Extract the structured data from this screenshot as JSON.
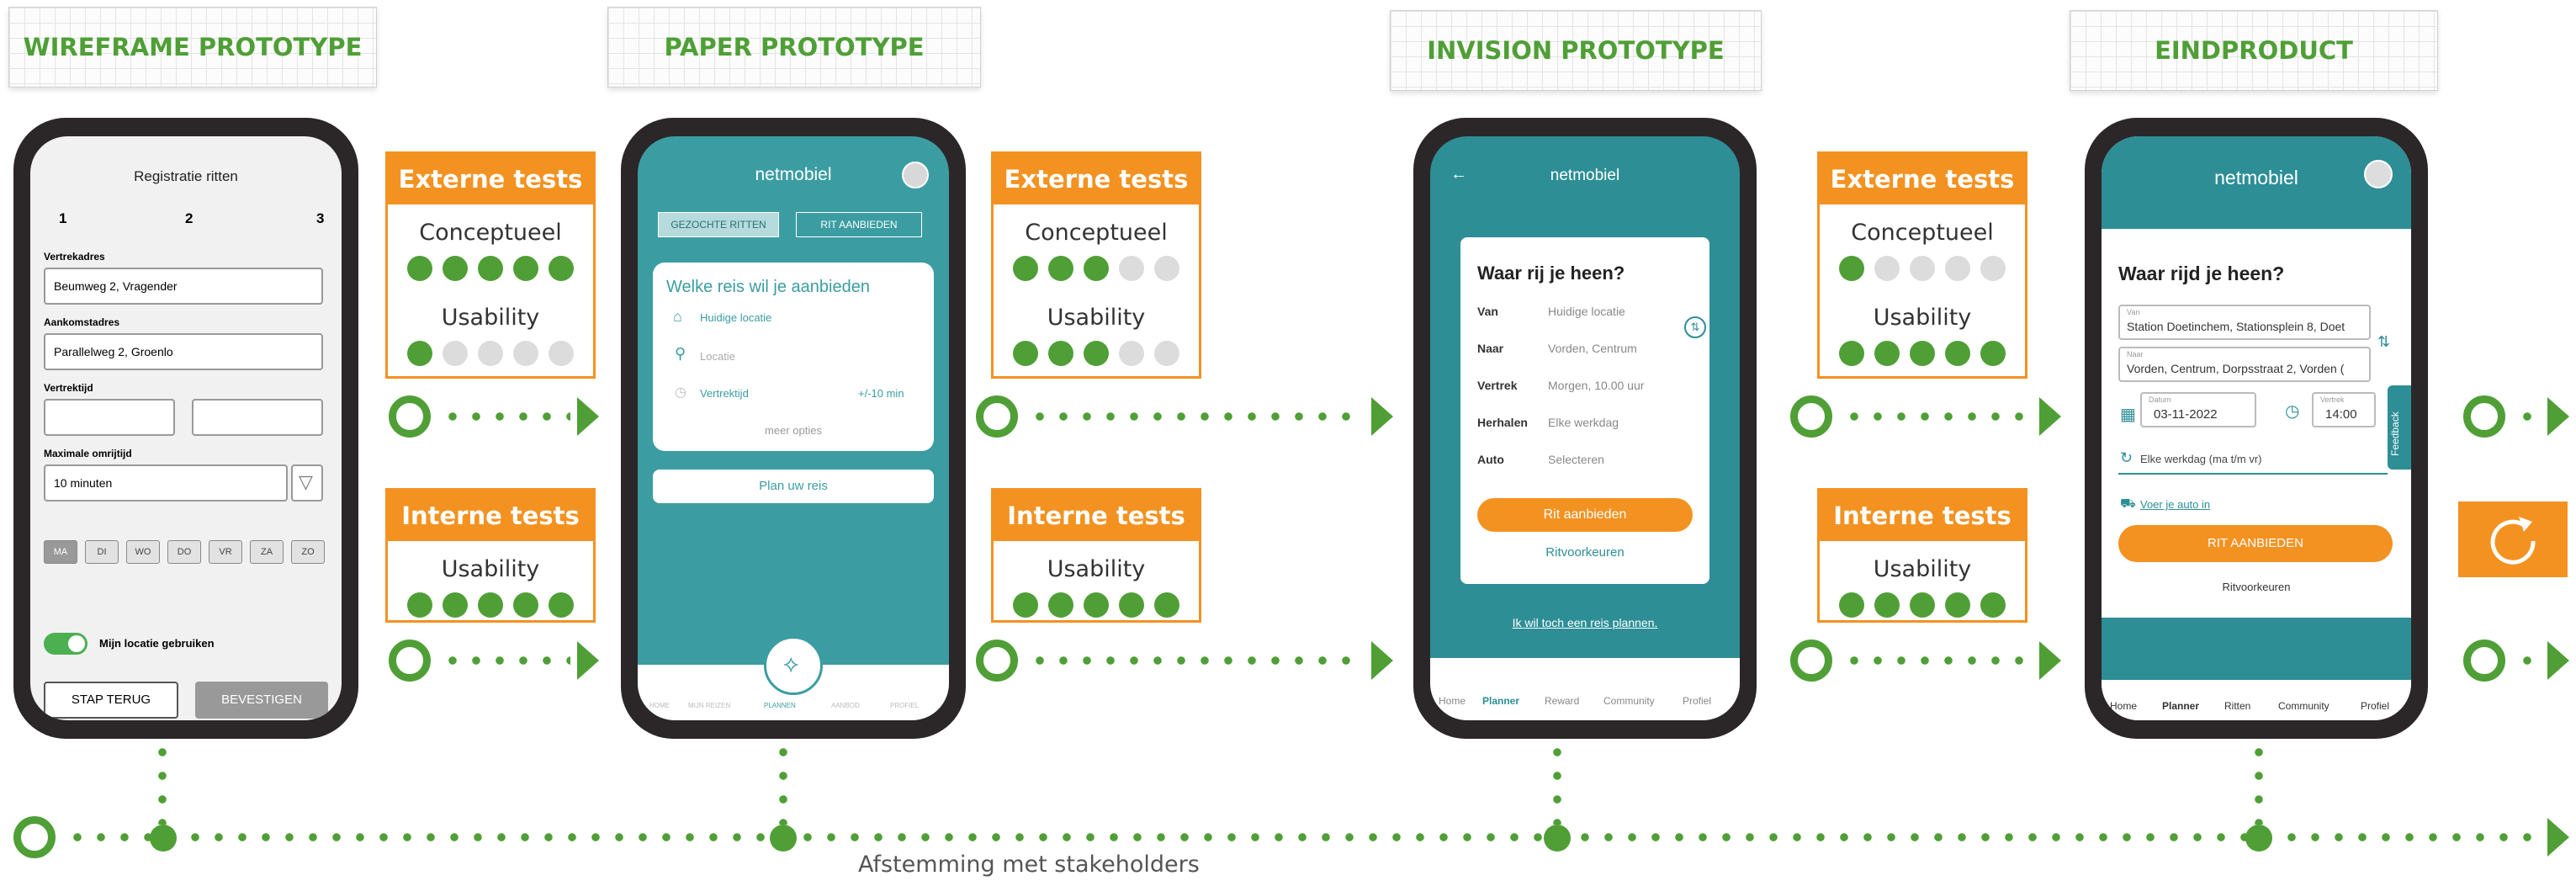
{
  "stages": [
    {
      "label": "WIREFRAME PROTOTYPE"
    },
    {
      "label": "PAPER PROTOTYPE"
    },
    {
      "label": "INVISION PROTOTYPE"
    },
    {
      "label": "EINDPRODUCT"
    }
  ],
  "tests": [
    {
      "external": {
        "title": "Externe tests",
        "conceptueel_label": "Conceptueel",
        "conceptueel": 5,
        "usability_label": "Usability",
        "usability": 1
      },
      "internal": {
        "title": "Interne tests",
        "usability_label": "Usability",
        "usability": 5
      }
    },
    {
      "external": {
        "title": "Externe tests",
        "conceptueel_label": "Conceptueel",
        "conceptueel": 3,
        "usability_label": "Usability",
        "usability": 3
      },
      "internal": {
        "title": "Interne tests",
        "usability_label": "Usability",
        "usability": 5
      }
    },
    {
      "external": {
        "title": "Externe tests",
        "conceptueel_label": "Conceptueel",
        "conceptueel": 1,
        "usability_label": "Usability",
        "usability": 5
      },
      "internal": {
        "title": "Interne tests",
        "usability_label": "Usability",
        "usability": 5
      }
    }
  ],
  "score_max": 5,
  "timeline_caption": "Afstemming met stakeholders",
  "colors": {
    "green": "#4f9f36",
    "orange": "#f39221",
    "teal": "#2d8e96",
    "phone": "#2b2729"
  },
  "wireframe": {
    "title": "Registratie ritten",
    "steps": [
      "1",
      "2",
      "3"
    ],
    "vertrekadres_label": "Vertrekadres",
    "vertrekadres_value": "Beumweg 2, Vragender",
    "aankomstadres_label": "Aankomstadres",
    "aankomstadres_value": "Parallelweg 2, Groenlo",
    "vertrektijd_label": "Vertrektijd",
    "omrijtijd_label": "Maximale omrijtijd",
    "omrijtijd_value": "10 minuten",
    "days": [
      "MA",
      "DI",
      "WO",
      "DO",
      "VR",
      "ZA",
      "ZO"
    ],
    "locatie_label": "Mijn locatie gebruiken",
    "back_label": "STAP TERUG",
    "confirm_label": "BEVESTIGEN"
  },
  "paper": {
    "brand": "netmobiel",
    "tab_gezocht": "GEZOCHTE RITTEN",
    "tab_aanbieden": "RIT AANBIEDEN",
    "question": "Welke reis wil je aanbieden",
    "huidige": "Huidige locatie",
    "locatie": "Locatie",
    "vertrektijd": "Vertrektijd",
    "marge": "+/-10 min",
    "meer": "meer opties",
    "plan": "Plan uw reis",
    "nav": [
      "HOME",
      "MIJN REIZEN",
      "PLANNEN",
      "AANBOD",
      "PROFIEL"
    ]
  },
  "invision": {
    "brand": "netmobiel",
    "question": "Waar rij je heen?",
    "rows": [
      {
        "label": "Van",
        "value": "Huidige locatie"
      },
      {
        "label": "Naar",
        "value": "Vorden, Centrum"
      },
      {
        "label": "Vertrek",
        "value": "Morgen, 10.00 uur"
      },
      {
        "label": "Herhalen",
        "value": "Elke werkdag"
      },
      {
        "label": "Auto",
        "value": "Selecteren"
      }
    ],
    "cta": "Rit aanbieden",
    "voorkeuren": "Ritvoorkeuren",
    "link": "Ik wil toch een reis plannen.",
    "nav": [
      "Home",
      "Planner",
      "Reward",
      "Community",
      "Profiel"
    ]
  },
  "eind": {
    "brand": "netmobiel",
    "question": "Waar rijd je heen?",
    "van_label": "Van",
    "van_value": "Station Doetinchem, Stationsplein 8, Doet",
    "naar_label": "Naar",
    "naar_value": "Vorden, Centrum, Dorpsstraat 2, Vorden (",
    "datum_label": "Datum",
    "datum_value": "03-11-2022",
    "vertrek_label": "Vertrek",
    "vertrek_value": "14:00",
    "herhaal": "Elke werkdag (ma t/m vr)",
    "auto_link": "Voer je auto in",
    "cta": "RIT AANBIEDEN",
    "voorkeuren": "Ritvoorkeuren",
    "feedback": "Feedback",
    "nav": [
      "Home",
      "Planner",
      "Ritten",
      "Community",
      "Profiel"
    ]
  }
}
